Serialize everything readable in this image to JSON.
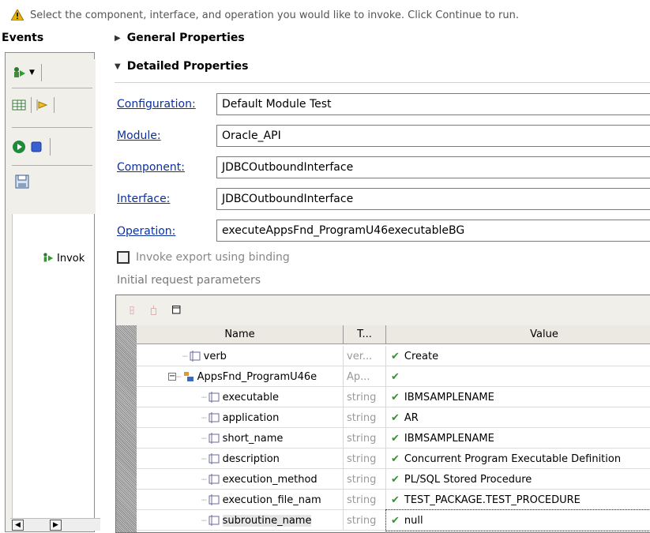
{
  "header": {
    "message": "Select the component, interface, and operation you would like to invoke. Click Continue to run.",
    "warning_icon": "warning-triangle-icon"
  },
  "events": {
    "title": "Events",
    "invoke_label": "Invok"
  },
  "sections": {
    "general": "General Properties",
    "detailed": "Detailed Properties"
  },
  "fields": {
    "configuration": {
      "label": "Configuration:",
      "value": "Default Module Test"
    },
    "module": {
      "label": "Module:",
      "value": "Oracle_API"
    },
    "component": {
      "label": "Component:",
      "value": "JDBCOutboundInterface"
    },
    "interface": {
      "label": "Interface:",
      "value": "JDBCOutboundInterface"
    },
    "operation": {
      "label": "Operation:",
      "value": "executeAppsFnd_ProgramU46executableBG"
    }
  },
  "binding_checkbox": {
    "label": "Invoke export using binding",
    "checked": false
  },
  "params_label": "Initial request parameters",
  "table": {
    "columns": {
      "name": "Name",
      "type": "T...",
      "value": "Value"
    },
    "rows": [
      {
        "name": "verb",
        "type": "ver...",
        "value": "Create"
      },
      {
        "name": "AppsFnd_ProgramU46e",
        "type": "Ap...",
        "value": ""
      },
      {
        "name": "executable",
        "type": "string",
        "value": "IBMSAMPLENAME"
      },
      {
        "name": "application",
        "type": "string",
        "value": "AR"
      },
      {
        "name": "short_name",
        "type": "string",
        "value": "IBMSAMPLENAME"
      },
      {
        "name": "description",
        "type": "string",
        "value": "Concurrent Program Executable Definition"
      },
      {
        "name": "execution_method",
        "type": "string",
        "value": "PL/SQL Stored Procedure"
      },
      {
        "name": "execution_file_nam",
        "type": "string",
        "value": "TEST_PACKAGE.TEST_PROCEDURE"
      },
      {
        "name": "subroutine_name",
        "type": "string",
        "value": "null"
      }
    ]
  },
  "colors": {
    "link": "#0b2fa0",
    "check": "#2a9a2a",
    "warning": "#e8b400"
  }
}
